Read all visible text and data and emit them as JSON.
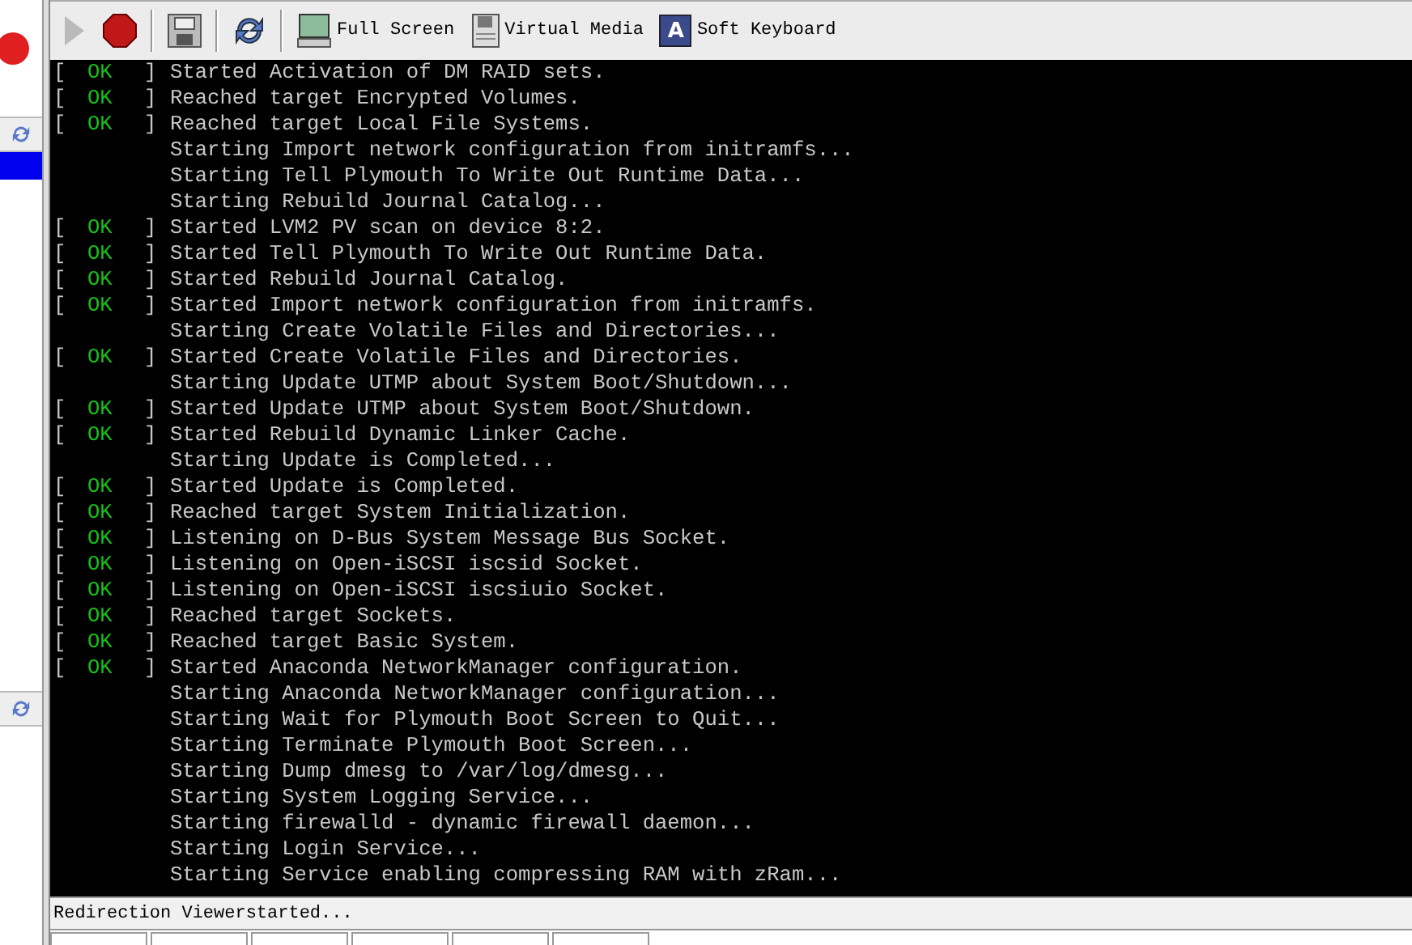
{
  "toolbar": {
    "buttons": [
      {
        "kind": "play",
        "disabled": true
      },
      {
        "kind": "stop",
        "disabled": false
      },
      {
        "kind": "save",
        "disabled": false
      },
      {
        "kind": "refresh",
        "disabled": false
      },
      {
        "kind": "monitor",
        "label": "Full Screen"
      },
      {
        "kind": "floppy",
        "label": "Virtual Media"
      },
      {
        "kind": "keyboard",
        "label": "Soft Keyboard",
        "key": "A"
      }
    ]
  },
  "console": {
    "lines": [
      {
        "kind": "ok",
        "open": "[",
        "status": "OK",
        "close": "]",
        "text": "Started Activation of DM RAID sets."
      },
      {
        "kind": "ok",
        "open": "[",
        "status": "OK",
        "close": "]",
        "text": "Reached target Encrypted Volumes."
      },
      {
        "kind": "ok",
        "open": "[",
        "status": "OK",
        "close": "]",
        "text": "Reached target Local File Systems."
      },
      {
        "kind": "plain",
        "text": "Starting Import network configuration from initramfs..."
      },
      {
        "kind": "plain",
        "text": "Starting Tell Plymouth To Write Out Runtime Data..."
      },
      {
        "kind": "plain",
        "text": "Starting Rebuild Journal Catalog..."
      },
      {
        "kind": "ok",
        "open": "[",
        "status": "OK",
        "close": "]",
        "text": "Started LVM2 PV scan on device 8:2."
      },
      {
        "kind": "ok",
        "open": "[",
        "status": "OK",
        "close": "]",
        "text": "Started Tell Plymouth To Write Out Runtime Data."
      },
      {
        "kind": "ok",
        "open": "[",
        "status": "OK",
        "close": "]",
        "text": "Started Rebuild Journal Catalog."
      },
      {
        "kind": "ok",
        "open": "[",
        "status": "OK",
        "close": "]",
        "text": "Started Import network configuration from initramfs."
      },
      {
        "kind": "plain",
        "text": "Starting Create Volatile Files and Directories..."
      },
      {
        "kind": "ok",
        "open": "[",
        "status": "OK",
        "close": "]",
        "text": "Started Create Volatile Files and Directories."
      },
      {
        "kind": "plain",
        "text": "Starting Update UTMP about System Boot/Shutdown..."
      },
      {
        "kind": "ok",
        "open": "[",
        "status": "OK",
        "close": "]",
        "text": "Started Update UTMP about System Boot/Shutdown."
      },
      {
        "kind": "ok",
        "open": "[",
        "status": "OK",
        "close": "]",
        "text": "Started Rebuild Dynamic Linker Cache."
      },
      {
        "kind": "plain",
        "text": "Starting Update is Completed..."
      },
      {
        "kind": "ok",
        "open": "[",
        "status": "OK",
        "close": "]",
        "text": "Started Update is Completed."
      },
      {
        "kind": "ok",
        "open": "[",
        "status": "OK",
        "close": "]",
        "text": "Reached target System Initialization."
      },
      {
        "kind": "ok",
        "open": "[",
        "status": "OK",
        "close": "]",
        "text": "Listening on D-Bus System Message Bus Socket."
      },
      {
        "kind": "ok",
        "open": "[",
        "status": "OK",
        "close": "]",
        "text": "Listening on Open-iSCSI iscsid Socket."
      },
      {
        "kind": "ok",
        "open": "[",
        "status": "OK",
        "close": "]",
        "text": "Listening on Open-iSCSI iscsiuio Socket."
      },
      {
        "kind": "ok",
        "open": "[",
        "status": "OK",
        "close": "]",
        "text": "Reached target Sockets."
      },
      {
        "kind": "ok",
        "open": "[",
        "status": "OK",
        "close": "]",
        "text": "Reached target Basic System."
      },
      {
        "kind": "ok",
        "open": "[",
        "status": "OK",
        "close": "]",
        "text": "Started Anaconda NetworkManager configuration."
      },
      {
        "kind": "plain",
        "text": "Starting Anaconda NetworkManager configuration..."
      },
      {
        "kind": "plain",
        "text": "Starting Wait for Plymouth Boot Screen to Quit..."
      },
      {
        "kind": "plain",
        "text": "Starting Terminate Plymouth Boot Screen..."
      },
      {
        "kind": "plain",
        "text": "Starting Dump dmesg to /var/log/dmesg..."
      },
      {
        "kind": "plain",
        "text": "Starting System Logging Service..."
      },
      {
        "kind": "plain",
        "text": "Starting firewalld - dynamic firewall daemon..."
      },
      {
        "kind": "plain",
        "text": "Starting Login Service..."
      },
      {
        "kind": "plain",
        "text": "Starting Service enabling compressing RAM with zRam..."
      }
    ]
  },
  "status_bar": {
    "text": "Redirection Viewerstarted..."
  }
}
